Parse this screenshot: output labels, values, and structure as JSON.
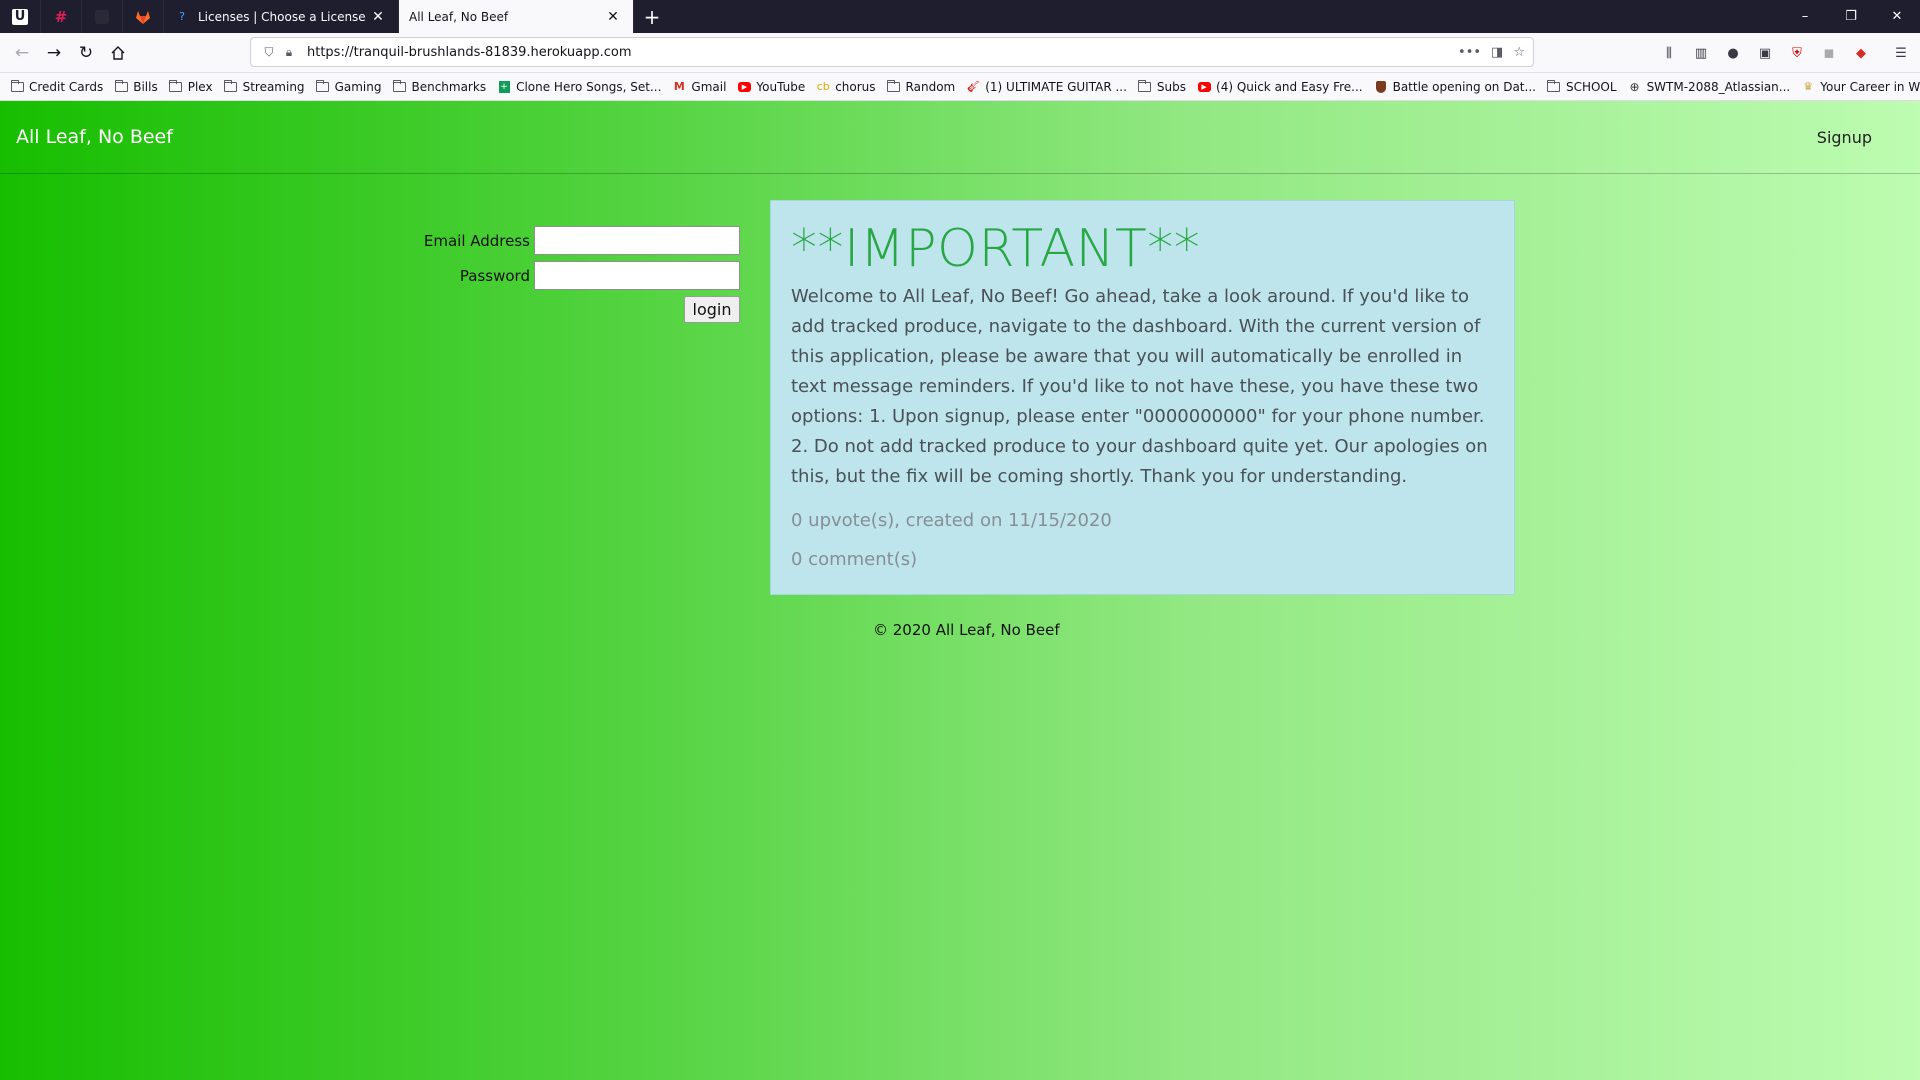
{
  "browser": {
    "pinned_tabs": [
      "u-logo-icon",
      "slack-icon",
      "dark-app-icon",
      "gitlab-icon"
    ],
    "tabs": [
      {
        "title": "Licenses | Choose a License",
        "icon": "question-icon",
        "active": false
      },
      {
        "title": "All Leaf, No Beef",
        "icon": "",
        "active": true
      }
    ],
    "new_tab_label": "+",
    "window_controls": {
      "minimize": "–",
      "restore": "❐",
      "close": "✕"
    },
    "url": "https://tranquil-brushlands-81839.herokuapp.com",
    "url_actions": {
      "more": "•••",
      "pocket": "◨",
      "bookmark": "☆"
    }
  },
  "bookmarks": [
    {
      "label": "Credit Cards",
      "icon": "folder-icon"
    },
    {
      "label": "Bills",
      "icon": "folder-icon"
    },
    {
      "label": "Plex",
      "icon": "folder-icon"
    },
    {
      "label": "Streaming",
      "icon": "folder-icon"
    },
    {
      "label": "Gaming",
      "icon": "folder-icon"
    },
    {
      "label": "Benchmarks",
      "icon": "folder-icon"
    },
    {
      "label": "Clone Hero Songs, Set...",
      "icon": "sheets-icon"
    },
    {
      "label": "Gmail",
      "icon": "gmail-icon"
    },
    {
      "label": "YouTube",
      "icon": "youtube-icon"
    },
    {
      "label": "chorus",
      "icon": "chorus-icon"
    },
    {
      "label": "Random",
      "icon": "folder-icon"
    },
    {
      "label": "(1) ULTIMATE GUITAR ...",
      "icon": "guitar-icon"
    },
    {
      "label": "Subs",
      "icon": "folder-icon"
    },
    {
      "label": "(4) Quick and Easy Fre...",
      "icon": "youtube-icon"
    },
    {
      "label": "Battle opening on Dat...",
      "icon": "shield-icon"
    },
    {
      "label": "SCHOOL",
      "icon": "folder-icon"
    },
    {
      "label": "SWTM-2088_Atlassian...",
      "icon": "globe-icon"
    },
    {
      "label": "Your Career in Web De...",
      "icon": "trophy-icon"
    }
  ],
  "site": {
    "brand": "All Leaf, No Beef",
    "signup": "Signup",
    "login": {
      "email_label": "Email Address",
      "password_label": "Password",
      "email_value": "",
      "password_value": "",
      "button": "login"
    },
    "notice": {
      "title": "**IMPORTANT**",
      "body": "Welcome to All Leaf, No Beef! Go ahead, take a look around. If you'd like to add tracked produce, navigate to the dashboard. With the current version of this application, please be aware that you will automatically be enrolled in text message reminders. If you'd like to not have these, you have these two options: 1. Upon signup, please enter \"0000000000\" for your phone number. 2. Do not add tracked produce to your dashboard quite yet. Our apologies on this, but the fix will be coming shortly. Thank you for understanding.",
      "meta": "0 upvote(s), created on 11/15/2020",
      "comments": "0 comment(s)"
    },
    "footer": "© 2020 All Leaf, No Beef"
  },
  "colors": {
    "gradient_start": "#17be00",
    "gradient_end": "#bdfcb1",
    "notice_bg": "#bee5eb",
    "notice_title": "#28a745"
  }
}
